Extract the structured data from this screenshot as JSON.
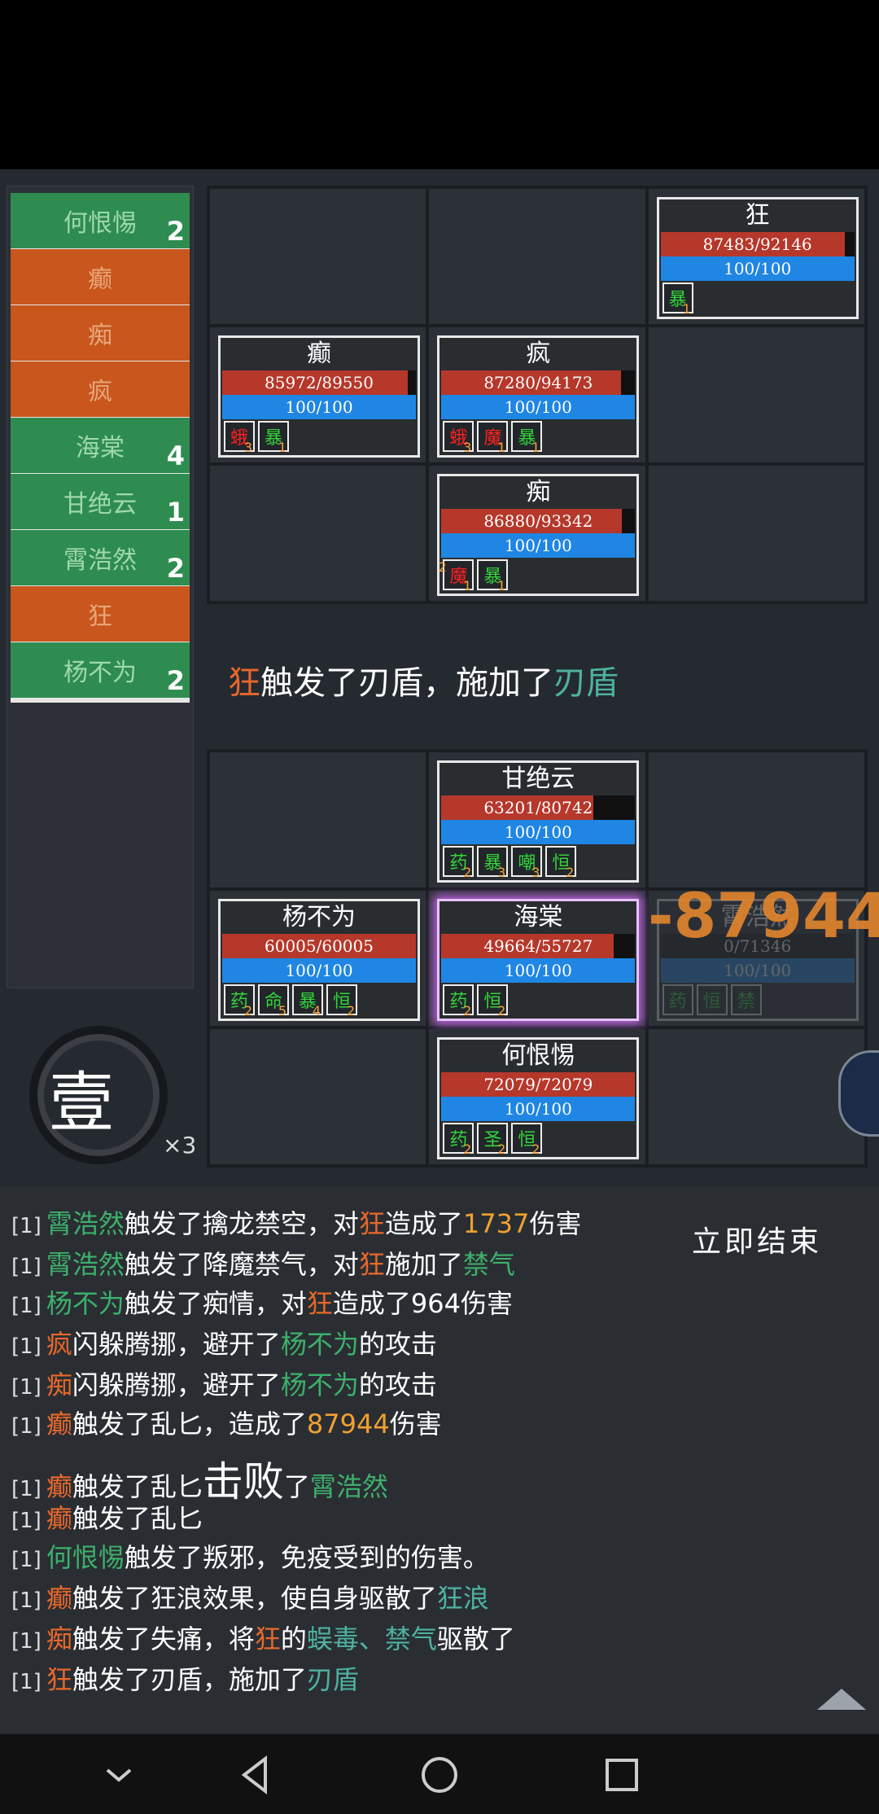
{
  "turn_order": [
    {
      "name": "何恨惕",
      "side": "ally",
      "count": "2"
    },
    {
      "name": "癫",
      "side": "enemy",
      "count": ""
    },
    {
      "name": "痴",
      "side": "enemy",
      "count": ""
    },
    {
      "name": "疯",
      "side": "enemy",
      "count": ""
    },
    {
      "name": "海棠",
      "side": "ally",
      "count": "4"
    },
    {
      "name": "甘绝云",
      "side": "ally",
      "count": "1"
    },
    {
      "name": "霄浩然",
      "side": "ally",
      "count": "2"
    },
    {
      "name": "狂",
      "side": "enemy",
      "count": ""
    },
    {
      "name": "杨不为",
      "side": "ally",
      "count": "2"
    }
  ],
  "round": {
    "glyph": "壹",
    "multiplier": "×3"
  },
  "enemy_units": {
    "kuang": {
      "name": "狂",
      "hp": "87483/92146",
      "hp_frac": 0.949,
      "mp": "100/100",
      "buffs": [
        {
          "t": "暴",
          "c": "g",
          "n": "1"
        }
      ]
    },
    "dian": {
      "name": "癫",
      "hp": "85972/89550",
      "hp_frac": 0.96,
      "mp": "100/100",
      "buffs": [
        {
          "t": "蛾",
          "c": "r",
          "n": "3"
        },
        {
          "t": "暴",
          "c": "g",
          "n": "1"
        }
      ]
    },
    "feng": {
      "name": "疯",
      "hp": "87280/94173",
      "hp_frac": 0.927,
      "mp": "100/100",
      "buffs": [
        {
          "t": "蛾",
          "c": "r",
          "n": "3"
        },
        {
          "t": "魔",
          "c": "r",
          "n": "1"
        },
        {
          "t": "暴",
          "c": "g",
          "n": "1"
        }
      ]
    },
    "chi": {
      "name": "痴",
      "hp": "86880/93342",
      "hp_frac": 0.931,
      "mp": "100/100",
      "buffs": [
        {
          "t": "魔",
          "c": "r",
          "n": "1",
          "pre": "2"
        },
        {
          "t": "暴",
          "c": "g",
          "n": "1"
        }
      ]
    }
  },
  "event_message": {
    "actor": "狂",
    "mid": "触发了刃盾，施加了",
    "effect": "刃盾"
  },
  "ally_units": {
    "gan": {
      "name": "甘绝云",
      "hp": "63201/80742",
      "hp_frac": 0.783,
      "mp": "100/100",
      "buffs": [
        {
          "t": "药",
          "c": "g",
          "n": "2"
        },
        {
          "t": "暴",
          "c": "g",
          "n": "3"
        },
        {
          "t": "嘲",
          "c": "g",
          "n": "3"
        },
        {
          "t": "恒",
          "c": "g",
          "n": "2"
        }
      ]
    },
    "yang": {
      "name": "杨不为",
      "hp": "60005/60005",
      "hp_frac": 1.0,
      "mp": "100/100",
      "buffs": [
        {
          "t": "药",
          "c": "g",
          "n": "2"
        },
        {
          "t": "命",
          "c": "g",
          "n": "5"
        },
        {
          "t": "暴",
          "c": "g",
          "n": "4"
        },
        {
          "t": "恒",
          "c": "g",
          "n": "2"
        }
      ]
    },
    "hai": {
      "name": "海棠",
      "hp": "49664/55727",
      "hp_frac": 0.891,
      "mp": "100/100",
      "buffs": [
        {
          "t": "药",
          "c": "g",
          "n": "2"
        },
        {
          "t": "恒",
          "c": "g",
          "n": "2"
        }
      ]
    },
    "xiao": {
      "name": "霄浩然",
      "hp": "0/71346",
      "hp_frac": 0.0,
      "mp": "100/100",
      "buffs": [
        {
          "t": "药",
          "c": "g",
          "n": ""
        },
        {
          "t": "恒",
          "c": "g",
          "n": ""
        },
        {
          "t": "禁",
          "c": "g",
          "n": ""
        }
      ]
    },
    "he": {
      "name": "何恨惕",
      "hp": "72079/72079",
      "hp_frac": 1.0,
      "mp": "100/100",
      "buffs": [
        {
          "t": "药",
          "c": "g",
          "n": "2"
        },
        {
          "t": "圣",
          "c": "g",
          "n": "2"
        },
        {
          "t": "恒",
          "c": "g",
          "n": "2"
        }
      ]
    }
  },
  "damage_popup": "-87944",
  "end_button": "立即结束",
  "log_tag": "[1]",
  "battle_log": [
    [
      [
        "霄浩然",
        "green"
      ],
      [
        "触发了擒龙禁空，对",
        ""
      ],
      [
        "狂",
        "orange"
      ],
      [
        "造成了",
        ""
      ],
      [
        "1737",
        "gold"
      ],
      [
        "伤害",
        ""
      ]
    ],
    [
      [
        "霄浩然",
        "green"
      ],
      [
        "触发了降魔禁气，对",
        ""
      ],
      [
        "狂",
        "orange"
      ],
      [
        "施加了",
        ""
      ],
      [
        "禁气",
        "green"
      ]
    ],
    [
      [
        "杨不为",
        "green"
      ],
      [
        "触发了痴情，对",
        ""
      ],
      [
        "狂",
        "orange"
      ],
      [
        "造成了964伤害",
        ""
      ]
    ],
    [
      [
        "疯",
        "orange"
      ],
      [
        "闪躲腾挪，避开了",
        ""
      ],
      [
        "杨不为",
        "green"
      ],
      [
        "的攻击",
        ""
      ]
    ],
    [
      [
        "痴",
        "orange"
      ],
      [
        "闪躲腾挪，避开了",
        ""
      ],
      [
        "杨不为",
        "green"
      ],
      [
        "的攻击",
        ""
      ]
    ],
    [
      [
        "癫",
        "orange"
      ],
      [
        "触发了乱匕，造成了",
        ""
      ],
      [
        "87944",
        "gold"
      ],
      [
        "伤害",
        ""
      ]
    ],
    [
      [
        "癫",
        "orange"
      ],
      [
        "触发了乱匕",
        ""
      ],
      [
        "击败",
        "big"
      ],
      [
        "了",
        ""
      ],
      [
        "霄浩然",
        "green"
      ]
    ],
    [
      [
        "癫",
        "orange"
      ],
      [
        "触发了乱匕",
        ""
      ]
    ],
    [
      [
        "何恨惕",
        "green"
      ],
      [
        "触发了叛邪，免疫受到的伤害。",
        ""
      ]
    ],
    [
      [
        "癫",
        "orange"
      ],
      [
        "触发了狂浪效果，使自身驱散了",
        ""
      ],
      [
        "狂浪",
        "teal"
      ]
    ],
    [
      [
        "痴",
        "orange"
      ],
      [
        "触发了失痛，将",
        ""
      ],
      [
        "狂",
        "orange"
      ],
      [
        "的",
        ""
      ],
      [
        "蜈毒、禁气",
        "teal"
      ],
      [
        "驱散了",
        ""
      ]
    ],
    [
      [
        "狂",
        "orange"
      ],
      [
        "触发了刃盾，施加了",
        ""
      ],
      [
        "刃盾",
        "teal"
      ]
    ]
  ],
  "nav": {
    "back": "back-icon",
    "home": "home-icon",
    "recents": "recents-icon",
    "hide": "chevron-down-icon"
  }
}
